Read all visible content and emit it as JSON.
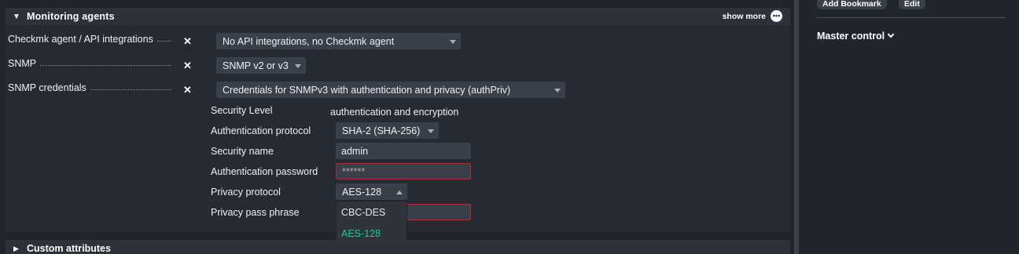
{
  "section": {
    "title": "Monitoring agents",
    "show_more": "show more",
    "show_more_icon": "more-dots-icon"
  },
  "rows": {
    "agent": {
      "label": "Checkmk agent / API integrations",
      "value": "No API integrations, no Checkmk agent"
    },
    "snmp": {
      "label": "SNMP",
      "value": "SNMP v2 or v3"
    },
    "credentials": {
      "label": "SNMP credentials",
      "value": "Credentials for SNMPv3 with authentication and privacy (authPriv)"
    }
  },
  "credentials": {
    "security_level": {
      "label": "Security Level",
      "value": "authentication and encryption"
    },
    "auth_protocol": {
      "label": "Authentication protocol",
      "value": "SHA-2 (SHA-256)"
    },
    "security_name": {
      "label": "Security name",
      "value": "admin"
    },
    "auth_password": {
      "label": "Authentication password",
      "value": "******"
    },
    "privacy_protocol": {
      "label": "Privacy protocol",
      "value": "AES-128",
      "options": [
        "CBC-DES",
        "AES-128"
      ],
      "selected": "AES-128"
    },
    "privacy_pass_phrase": {
      "label": "Privacy pass phrase",
      "value": ""
    }
  },
  "custom_attributes": {
    "title": "Custom attributes"
  },
  "sidebar": {
    "add_bookmark": "Add Bookmark",
    "edit": "Edit",
    "master_control": "Master control"
  },
  "colors": {
    "background": "#21252c",
    "panel": "#262b33",
    "header": "#2c313a",
    "selected_option": "#13d389",
    "invalid_border": "#b02a35"
  }
}
